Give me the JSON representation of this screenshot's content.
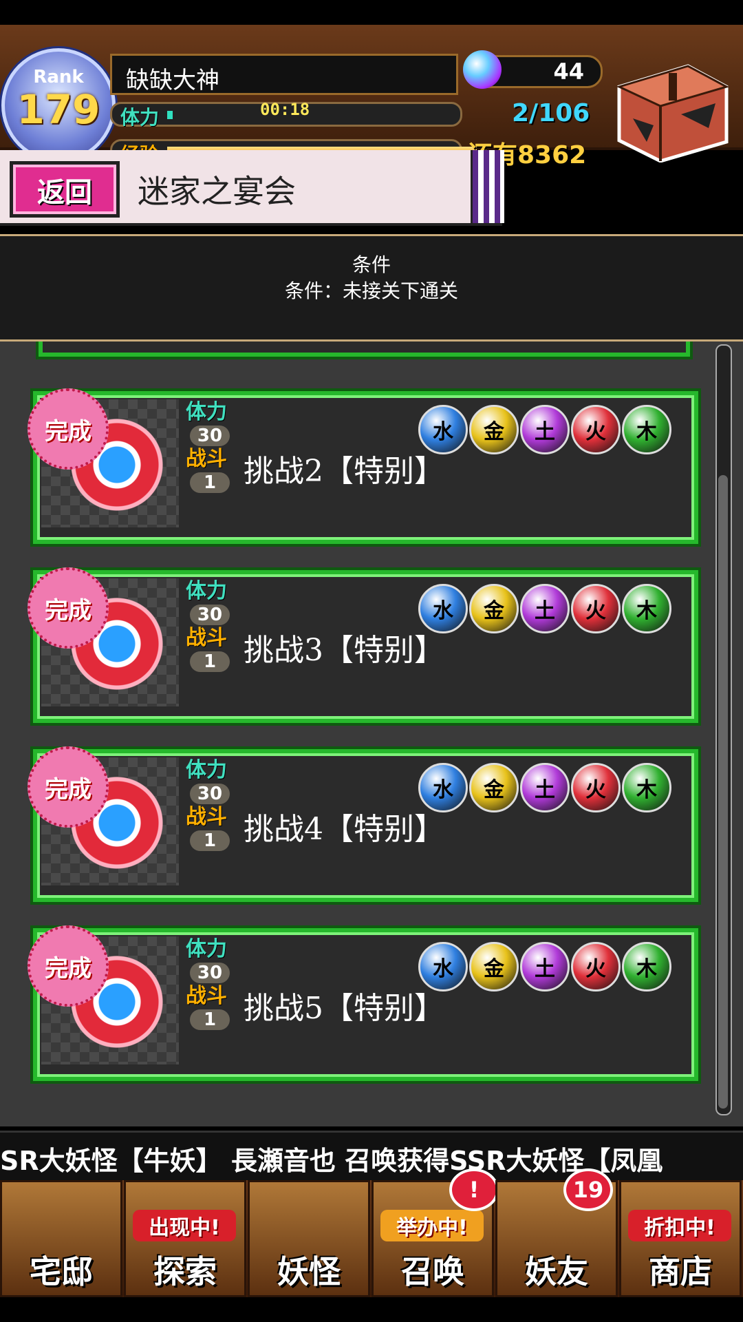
{
  "header": {
    "rank_label": "Rank",
    "rank_value": "179",
    "player_name": "缺缺大神",
    "stamina_label": "体力",
    "stamina_timer": "00:18",
    "stamina_count": "2/106",
    "exp_label": "经验",
    "exp_remaining": "还有8362",
    "orb_count": "44"
  },
  "title_bar": {
    "back_label": "返回",
    "title": "迷家之宴会"
  },
  "condition": {
    "title": "条件",
    "text": "条件：未接关下通关"
  },
  "stages": [
    {
      "complete_label": "完成",
      "stamina_label": "体力",
      "stamina_cost": "30",
      "battle_label": "战斗",
      "battle_count": "1",
      "title": "挑战2【特别】"
    },
    {
      "complete_label": "完成",
      "stamina_label": "体力",
      "stamina_cost": "30",
      "battle_label": "战斗",
      "battle_count": "1",
      "title": "挑战3【特别】"
    },
    {
      "complete_label": "完成",
      "stamina_label": "体力",
      "stamina_cost": "30",
      "battle_label": "战斗",
      "battle_count": "1",
      "title": "挑战4【特别】"
    },
    {
      "complete_label": "完成",
      "stamina_label": "体力",
      "stamina_cost": "30",
      "battle_label": "战斗",
      "battle_count": "1",
      "title": "挑战5【特别】"
    }
  ],
  "element_orbs": [
    {
      "glyph": "水",
      "color": "#2f7fe0"
    },
    {
      "glyph": "金",
      "color": "#e8c21a"
    },
    {
      "glyph": "土",
      "color": "#b03ad8"
    },
    {
      "glyph": "火",
      "color": "#e0303a"
    },
    {
      "glyph": "木",
      "color": "#30b030"
    }
  ],
  "ticker": {
    "text": "SR大妖怪【牛妖】      長瀬音也 召唤获得SSR大妖怪【凤凰"
  },
  "nav": {
    "items": [
      {
        "label": "宅邸",
        "tag": "",
        "badge": ""
      },
      {
        "label": "探索",
        "tag": "出现中!",
        "badge": ""
      },
      {
        "label": "妖怪",
        "tag": "",
        "badge": ""
      },
      {
        "label": "召唤",
        "tag": "举办中!",
        "badge": "!"
      },
      {
        "label": "妖友",
        "tag": "",
        "badge": "19"
      },
      {
        "label": "商店",
        "tag": "折扣中!",
        "badge": ""
      }
    ]
  },
  "colors": {
    "card_border": "#26b82c",
    "stamina_label": "#40e0c0",
    "battle_label": "#ffb000"
  }
}
